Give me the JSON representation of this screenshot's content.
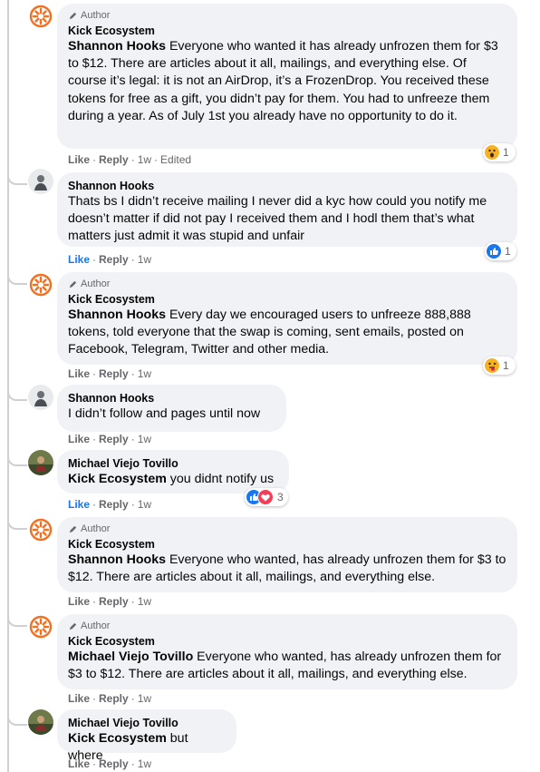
{
  "actions": {
    "like": "Like",
    "reply": "Reply",
    "dot": "·"
  },
  "comments": [
    {
      "author_badge": "Author",
      "name": "Kick Ecosystem",
      "mention": "Shannon Hooks",
      "text": " Everyone who wanted it has already unfrozen them for $3 to $12. There are articles about it all, mailings, and everything else. Of course it’s legal: it is not an AirDrop, it’s a FrozenDrop. You received these tokens for free as a gift, you didn’t pay for them. You had to unfreeze them during a year. As of July 1st you already have no opportunity to do it.",
      "time": "1w",
      "edited": "Edited",
      "reaction": {
        "type": "wow",
        "count": "1"
      }
    },
    {
      "name": "Shannon Hooks",
      "text": "Thats bs I didn’t receive mailing I never did a kyc how could you notify me doesn’t matter if did not pay I received them and I hodl them that’s what matters just admit it was stupid and unfair",
      "time": "1w",
      "reaction": {
        "type": "like",
        "count": "1"
      }
    },
    {
      "author_badge": "Author",
      "name": "Kick Ecosystem",
      "mention": "Shannon Hooks",
      "text": " Every day we encouraged users to unfreeze 888,888 tokens, told everyone that the swap is coming, sent emails, posted on Facebook, Telegram, Twitter and other media.",
      "time": "1w",
      "reaction": {
        "type": "tongue",
        "count": "1"
      }
    },
    {
      "name": "Shannon Hooks",
      "text": "I didn’t follow and pages until now",
      "time": "1w"
    },
    {
      "name": "Michael Viejo Tovillo",
      "mention": "Kick Ecosystem",
      "text": " you didnt notify us",
      "time": "1w",
      "reaction": {
        "type": "like-love",
        "count": "3"
      }
    },
    {
      "author_badge": "Author",
      "name": "Kick Ecosystem",
      "mention": "Shannon Hooks",
      "text": " Everyone who wanted, has already unfrozen them for $3 to $12. There are articles about it all, mailings, and everything else.",
      "time": "1w"
    },
    {
      "author_badge": "Author",
      "name": "Kick Ecosystem",
      "mention": "Michael Viejo Tovillo",
      "text": " Everyone who wanted, has already unfrozen them for $3 to $12. There are articles about it all, mailings, and everything else.",
      "time": "1w"
    },
    {
      "name": "Michael Viejo Tovillo",
      "mention": "Kick Ecosystem",
      "text": " but where",
      "time": "1w"
    }
  ],
  "colors": {
    "kick_orange": "#f37021",
    "like_blue": "#1877f2",
    "love_red": "#f33e58",
    "wow_yellow": "#f7b125"
  }
}
